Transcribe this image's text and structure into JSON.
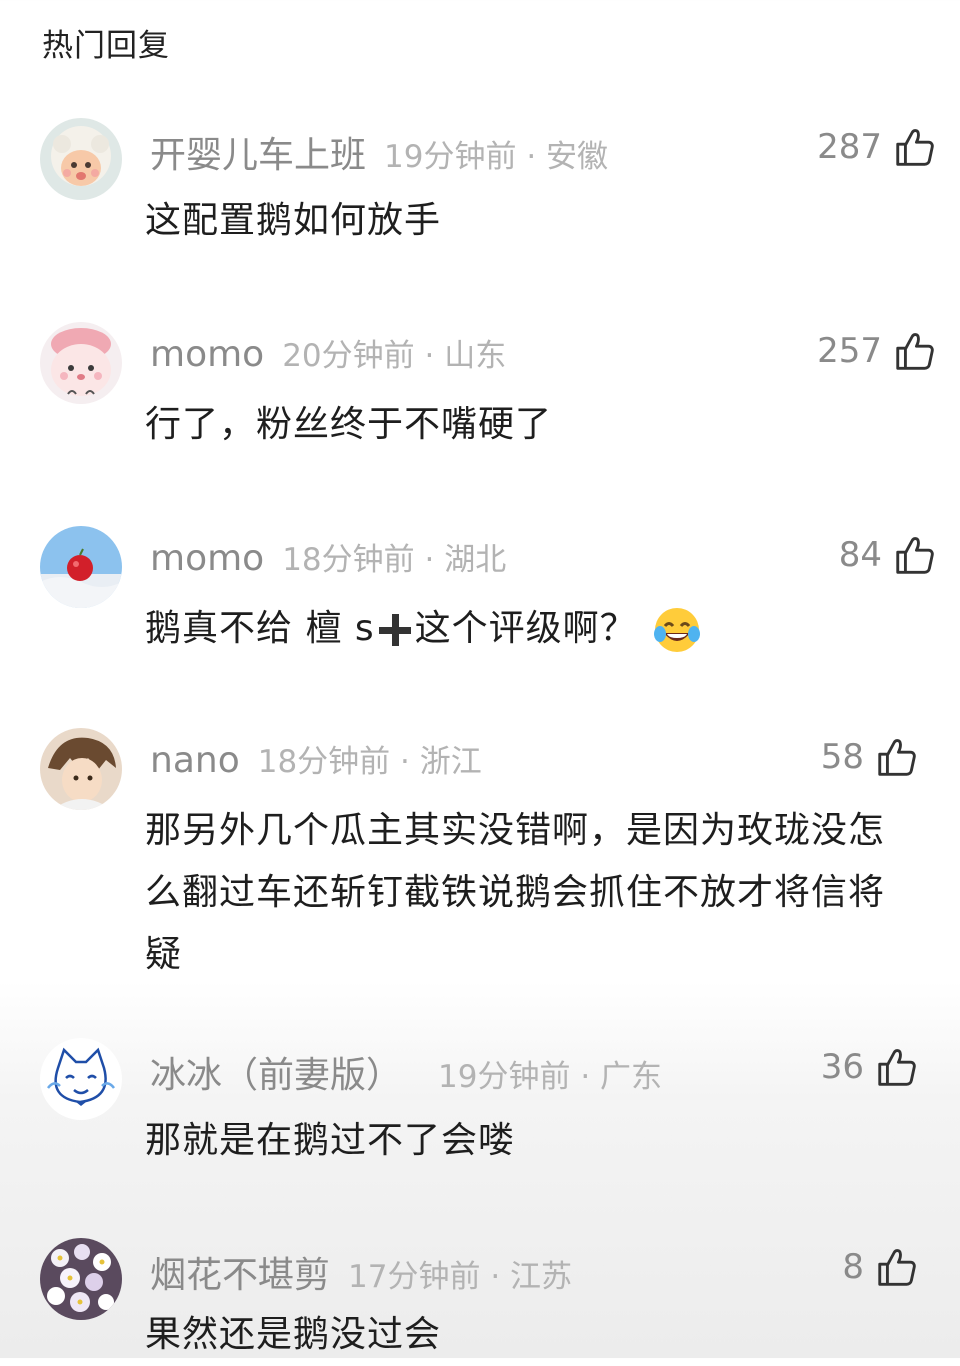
{
  "section_title": "热门回复",
  "comments": [
    {
      "username": "开婴儿车上班",
      "time_loc": "19分钟前 · 安徽",
      "likes": "287",
      "text": "这配置鹅如何放手"
    },
    {
      "username": "momo",
      "time_loc": "20分钟前 · 山东",
      "likes": "257",
      "text": "行了，粉丝终于不嘴硬了"
    },
    {
      "username": "momo",
      "time_loc": "18分钟前 · 湖北",
      "likes": "84",
      "text_before": "鹅真不给 檀 s",
      "text_after": "这个评级啊？",
      "emoji": "laughing-tears-emoji"
    },
    {
      "username": "nano",
      "time_loc": "18分钟前 · 浙江",
      "likes": "58",
      "text": "那另外几个瓜主其实没错啊，是因为玫珑没怎么翻过车还斩钉截铁说鹅会抓住不放才将信将疑"
    },
    {
      "username": "冰冰（前妻版）",
      "time_loc": "19分钟前 · 广东",
      "likes": "36",
      "text": "那就是在鹅过不了会喽"
    },
    {
      "username": "烟花不堪剪",
      "time_loc": "17分钟前 · 江苏",
      "likes": "8",
      "text": "果然还是鹅没过会"
    }
  ],
  "icons": {
    "like": "thumbs-up-icon"
  }
}
